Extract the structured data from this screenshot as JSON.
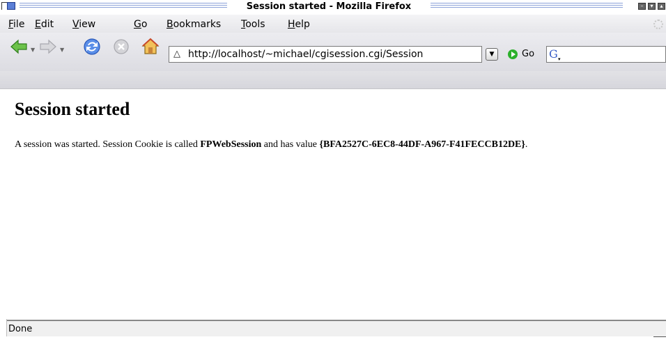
{
  "window": {
    "title": "Session started - Mozilla Firefox"
  },
  "menu": {
    "items": [
      {
        "key": "F",
        "rest": "ile"
      },
      {
        "key": "E",
        "rest": "dit"
      },
      {
        "key": "V",
        "rest": "iew"
      },
      {
        "key": "G",
        "rest": "o"
      },
      {
        "key": "B",
        "rest": "ookmarks"
      },
      {
        "key": "T",
        "rest": "ools"
      },
      {
        "key": "H",
        "rest": "elp"
      }
    ]
  },
  "toolbar": {
    "url": "http://localhost/~michael/cgisession.cgi/Session",
    "go_label": "Go",
    "icons": [
      "back-icon",
      "forward-icon",
      "reload-icon",
      "stop-icon",
      "home-icon"
    ]
  },
  "search": {
    "engine_icon": "G"
  },
  "page": {
    "heading": "Session started",
    "text_before": "A session was started. Session Cookie is called ",
    "cookie_name": "FPWebSession",
    "text_middle": " and has value ",
    "cookie_value": "{BFA2527C-6EC8-44DF-A967-F41FECCB12DE}",
    "text_after": "."
  },
  "status": {
    "text": "Done"
  },
  "colors": {
    "back_arrow": "#5dbb3a",
    "reload": "#3b6fd8",
    "go": "#2bb02b"
  }
}
